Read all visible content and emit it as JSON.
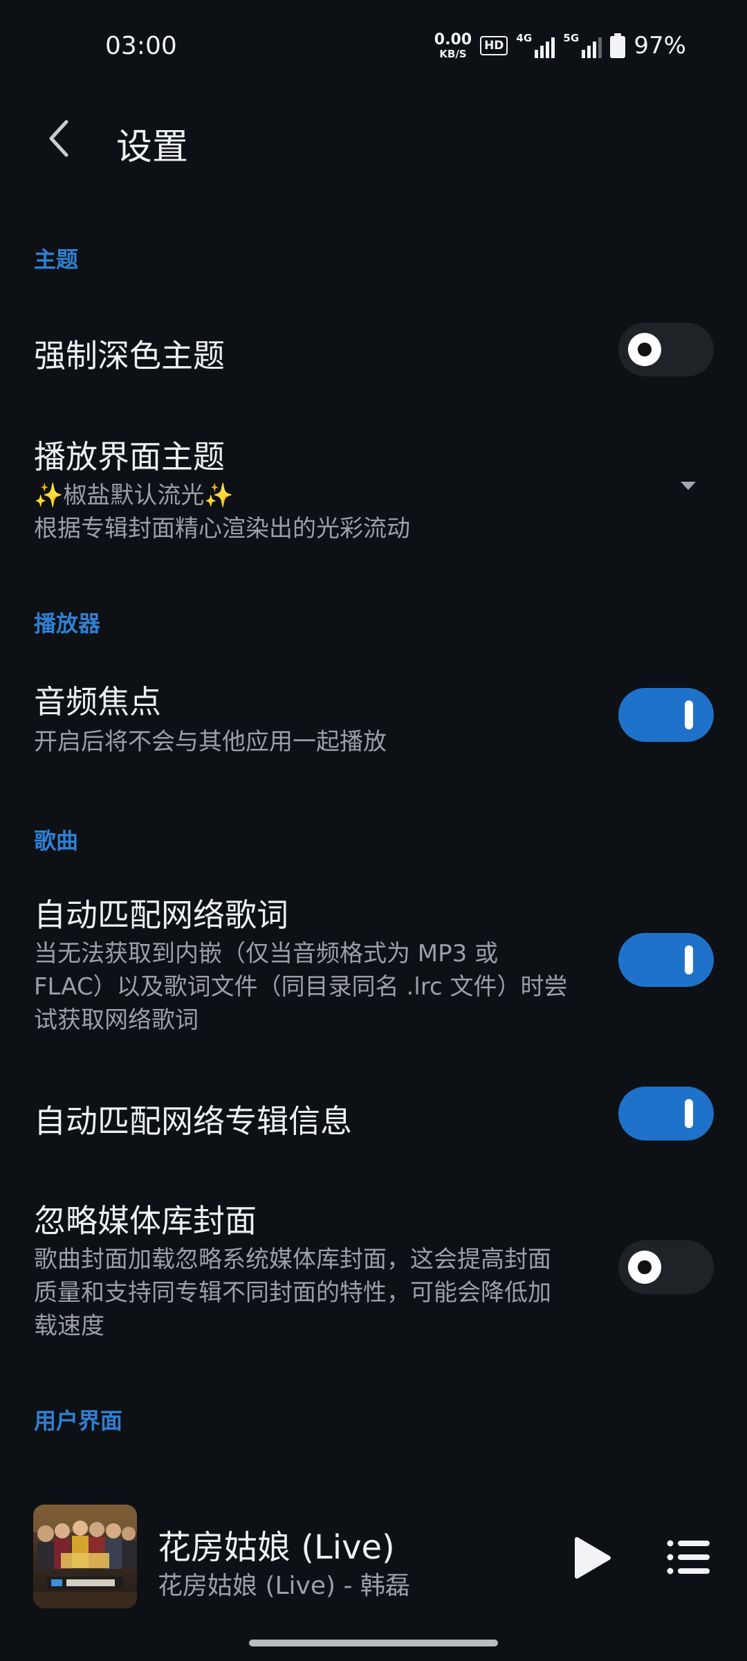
{
  "status_bar": {
    "time": "03:00",
    "net_speed_value": "0.00",
    "net_speed_unit": "KB/S",
    "hd_badge": "HD",
    "signal_1_label": "4G",
    "signal_2_label": "5G",
    "battery_percent": "97%",
    "icons": [
      "hd-icon",
      "signal-4g-icon",
      "signal-5g-icon",
      "battery-icon"
    ]
  },
  "header": {
    "back_icon": "chevron-left-icon",
    "title": "设置"
  },
  "sections": {
    "theme": {
      "header": "主题",
      "force_dark": {
        "title": "强制深色主题",
        "enabled": false
      },
      "player_theme": {
        "title": "播放界面主题",
        "value": "✨椒盐默认流光✨",
        "description": "根据专辑封面精心渲染出的光彩流动",
        "icon": "dropdown-caret-icon"
      }
    },
    "player": {
      "header": "播放器",
      "audio_focus": {
        "title": "音频焦点",
        "description": "开启后将不会与其他应用一起播放",
        "enabled": true
      }
    },
    "songs": {
      "header": "歌曲",
      "auto_lyrics": {
        "title": "自动匹配网络歌词",
        "description_lines": [
          "当无法获取到内嵌（仅当音频格式为 MP3 或",
          "FLAC）以及歌词文件（同目录同名 .lrc 文件）时尝",
          "试获取网络歌词"
        ],
        "enabled": true
      },
      "auto_album": {
        "title": "自动匹配网络专辑信息",
        "enabled": true
      },
      "ignore_media_cover": {
        "title": "忽略媒体库封面",
        "description_lines": [
          "歌曲封面加载忽略系统媒体库封面，这会提高封面",
          "质量和支持同专辑不同封面的特性，可能会降低加",
          "载速度"
        ],
        "enabled": false
      }
    },
    "ui": {
      "header": "用户界面"
    }
  },
  "mini_player": {
    "song_title": "花房姑娘 (Live)",
    "song_subtitle": "花房姑娘 (Live) - 韩磊",
    "icons": [
      "play-icon",
      "queue-list-icon"
    ]
  },
  "colors": {
    "background": "#0d1014",
    "accent": "#2f80d4",
    "toggle_on": "#1f72c9",
    "toggle_off": "#1f2226"
  }
}
